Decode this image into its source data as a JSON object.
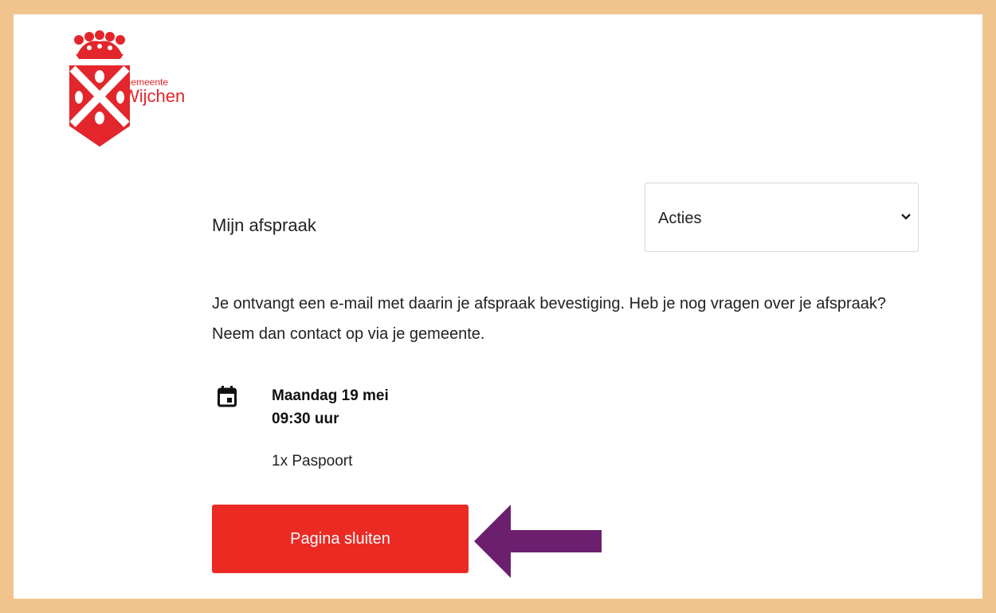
{
  "brand": {
    "logo_line1": "Gemeente",
    "logo_line2": "Wijchen",
    "color": "#e3262b",
    "icon": "wijchen-coat-of-arms-icon"
  },
  "header": {
    "title": "Mijn afspraak"
  },
  "actions": {
    "selected": "Acties",
    "icon": "chevron-down-icon"
  },
  "message": "Je ontvangt een e-mail met daarin je afspraak bevestiging. Heb je nog vragen over je afspraak? Neem dan contact op via je gemeente.",
  "appointment": {
    "icon": "calendar-icon",
    "date": "Maandag 19 mei",
    "time": "09:30 uur",
    "product": "1x Paspoort"
  },
  "close_button": {
    "label": "Pagina sluiten",
    "color": "#eb2a24"
  },
  "annotation": {
    "arrow_color": "#6b1f6e",
    "icon": "arrow-left-icon"
  },
  "frame_color": "#f2c48d"
}
